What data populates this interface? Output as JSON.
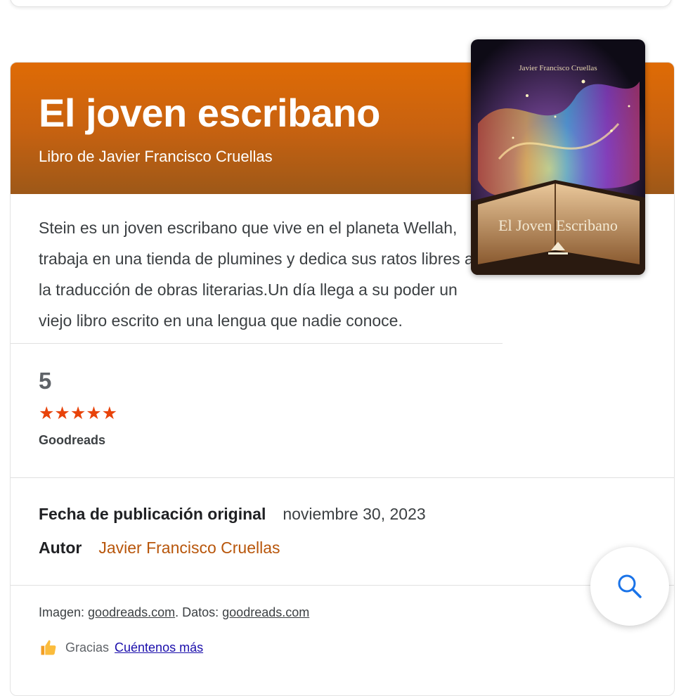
{
  "book": {
    "title": "El joven escribano",
    "subtitle": "Libro de Javier Francisco Cruellas",
    "description": "Stein es un joven escribano que vive en el planeta Wellah, trabaja en una tienda de plumines y dedica sus ratos libres a la traducción de obras literarias.Un día llega a su poder un viejo libro escrito en una lengua que nadie conoce.",
    "cover": {
      "author_text": "Javier Francisco Cruellas",
      "title_text": "El Joven Escribano"
    }
  },
  "rating": {
    "value": "5",
    "stars": "★★★★★",
    "stars_count": 5,
    "source": "Goodreads"
  },
  "facts": {
    "pub_label": "Fecha de publicación original",
    "pub_value": "noviembre 30, 2023",
    "author_label": "Autor",
    "author_value": "Javier Francisco Cruellas"
  },
  "footer": {
    "image_prefix": "Imagen: ",
    "image_source": "goodreads.com",
    "data_prefix": ". Datos: ",
    "data_source": "goodreads.com",
    "thanks": "Gracias",
    "tell_more": "Cuéntenos más"
  },
  "colors": {
    "header_top": "#df6b05",
    "header_bottom": "#9d5818",
    "stars": "#e8430a",
    "author_link": "#b8560b",
    "feedback_link": "#1a0dab",
    "search_icon": "#1a73e8"
  },
  "icons": {
    "search": "search-icon",
    "thumb": "thumbs-up-icon"
  }
}
